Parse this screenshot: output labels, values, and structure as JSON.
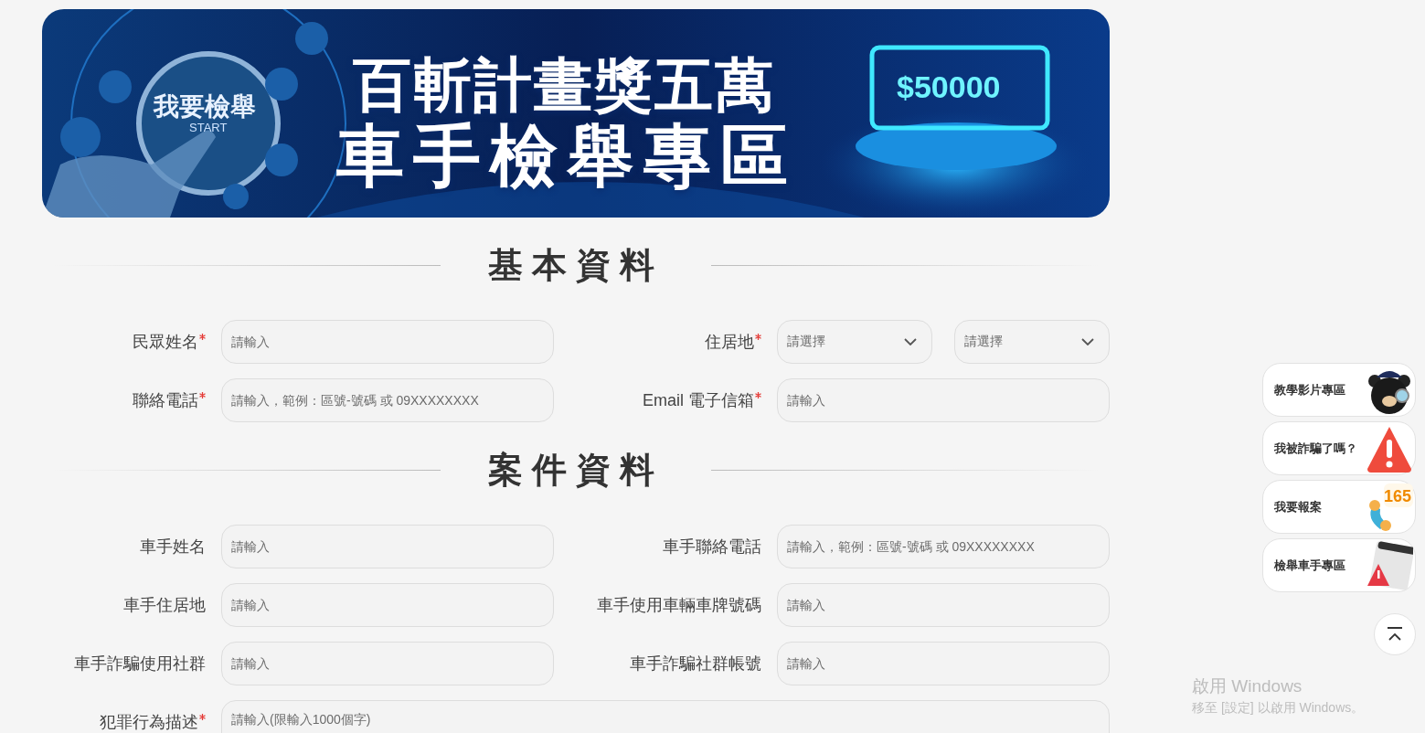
{
  "banner": {
    "headline": [
      "百斬計畫獎五萬",
      "車手檢舉專區"
    ],
    "start_label": "我要檢舉",
    "start_sub": "START",
    "prize": "$50000"
  },
  "sections": [
    {
      "title": "基本資料",
      "fields": [
        {
          "kind": "text",
          "label": "民眾姓名",
          "required": true,
          "placeholder": "請輸入"
        },
        {
          "kind": "select_pair",
          "label": "住居地",
          "required": true,
          "placeholders": [
            "請選擇",
            "請選擇"
          ]
        },
        {
          "kind": "text",
          "label": "聯絡電話",
          "required": true,
          "placeholder": "請輸入，範例：區號-號碼 或 09XXXXXXXX"
        },
        {
          "kind": "text",
          "label": "Email 電子信箱",
          "required": true,
          "placeholder": "請輸入"
        }
      ]
    },
    {
      "title": "案件資料",
      "fields": [
        {
          "kind": "text",
          "label": "車手姓名",
          "required": false,
          "placeholder": "請輸入"
        },
        {
          "kind": "text",
          "label": "車手聯絡電話",
          "required": false,
          "placeholder": "請輸入，範例：區號-號碼 或 09XXXXXXXX"
        },
        {
          "kind": "text",
          "label": "車手住居地",
          "required": false,
          "placeholder": "請輸入"
        },
        {
          "kind": "text",
          "label": "車手使用車輛車牌號碼",
          "required": false,
          "placeholder": "請輸入"
        },
        {
          "kind": "text",
          "label": "車手詐騙使用社群",
          "required": false,
          "placeholder": "請輸入"
        },
        {
          "kind": "text",
          "label": "車手詐騙社群帳號",
          "required": false,
          "placeholder": "請輸入"
        },
        {
          "kind": "textarea",
          "label": "犯罪行為描述",
          "required": true,
          "placeholder": "請輸入(限輸入1000個字)"
        }
      ]
    }
  ],
  "side_links": [
    {
      "kind": "mascot",
      "label": "教學影片專區"
    },
    {
      "kind": "warning",
      "label": "我被詐騙了嗎？"
    },
    {
      "kind": "phone",
      "label": "我要報案",
      "badge": "165"
    },
    {
      "kind": "browser",
      "label": "檢舉車手專區"
    }
  ],
  "os_notice": {
    "title": "啟用 Windows",
    "message": "移至 [設定] 以啟用 Windows。"
  }
}
